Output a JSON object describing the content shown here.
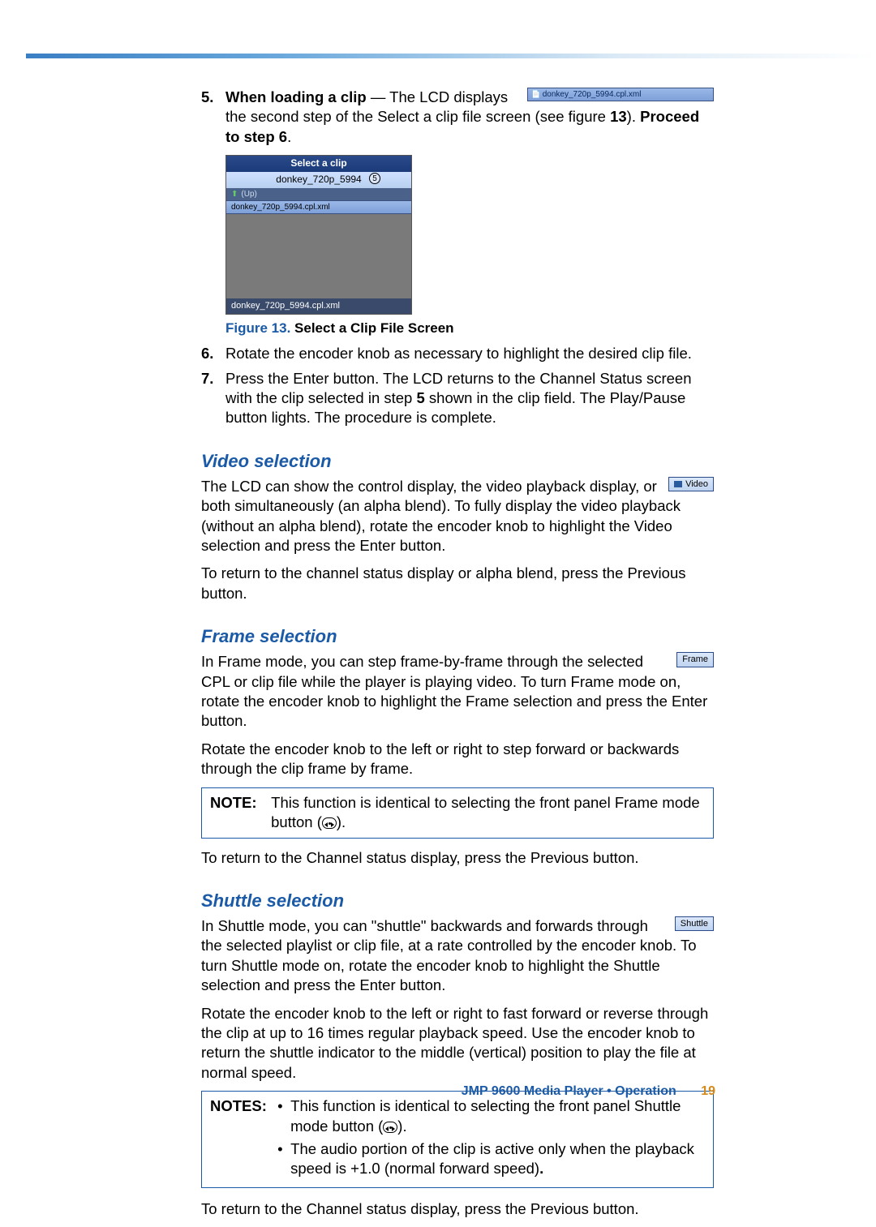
{
  "step5": {
    "num": "5.",
    "lead_bold": "When loading a clip",
    "lead_dash": " — The LCD displays the",
    "inline_img_text": "donkey_720p_5994.cpl.xml",
    "cont1": "second step of the Select a clip file screen (see figure ",
    "figref_bold": "13",
    "cont2": "). ",
    "proceed_bold": "Proceed to step 6",
    "cont3": "."
  },
  "clipscreen": {
    "header": "Select a clip",
    "sub": "donkey_720p_5994",
    "circle": "5",
    "row_up": "(Up)",
    "row_sel": "donkey_720p_5994.cpl.xml",
    "footer": "donkey_720p_5994.cpl.xml"
  },
  "figcaption": {
    "fig": "Figure 13.",
    "txt": " Select a Clip File Screen"
  },
  "step6": {
    "num": "6.",
    "txt": "Rotate the encoder knob as necessary to highlight the desired clip file."
  },
  "step7": {
    "num": "7.",
    "t1": "Press the Enter button. The LCD returns to the Channel Status screen with the clip selected in step ",
    "b": "5",
    "t2": " shown in the clip field. The Play/Pause button lights. The procedure is complete."
  },
  "video": {
    "heading": "Video selection",
    "badge": "Video",
    "p1": "The LCD can show the control display, the video playback display, or both simultaneously (an alpha blend). To fully display the video playback (without an alpha blend), rotate the encoder knob to highlight the Video selection and press the Enter button.",
    "p2": "To return to the channel status display or alpha blend, press the Previous button."
  },
  "frame": {
    "heading": "Frame selection",
    "badge": "Frame",
    "p1": "In Frame mode, you can step frame-by-frame through the selected CPL or clip file while the player is playing video. To turn Frame mode on, rotate the encoder knob to highlight the Frame selection and press the Enter button.",
    "p2": "Rotate the encoder knob to the left or right to step forward or backwards through the clip frame by frame.",
    "note_label": "NOTE:",
    "note_t1": "This function is identical to selecting the front panel Frame mode button (",
    "note_t2": ").",
    "p3": "To return to the Channel status display, press the Previous button."
  },
  "shuttle": {
    "heading": "Shuttle selection",
    "badge": "Shuttle",
    "p1": "In Shuttle mode, you can \"shuttle\" backwards and forwards through the selected playlist or clip file, at a rate controlled by the encoder knob. To turn Shuttle mode on, rotate the encoder knob to highlight the Shuttle selection and press the Enter button.",
    "p2": "Rotate the encoder knob to the left or right to fast forward or reverse through the clip at up to 16 times regular playback speed. Use the encoder knob to return the shuttle indicator to the middle (vertical) position to play the file at normal speed.",
    "notes_label": "NOTES:",
    "notes_b1_t1": "This function is identical to selecting the front panel Shuttle mode button (",
    "notes_b1_t2": ").",
    "notes_b2_t1": "The audio portion of the clip is active only when the playback speed is +1.0 (normal forward speed)",
    "notes_b2_t2": ".",
    "p3": "To return to the Channel status display, press the Previous button."
  },
  "footer": {
    "txt": "JMP 9600 Media Player • Operation",
    "page": "19"
  }
}
